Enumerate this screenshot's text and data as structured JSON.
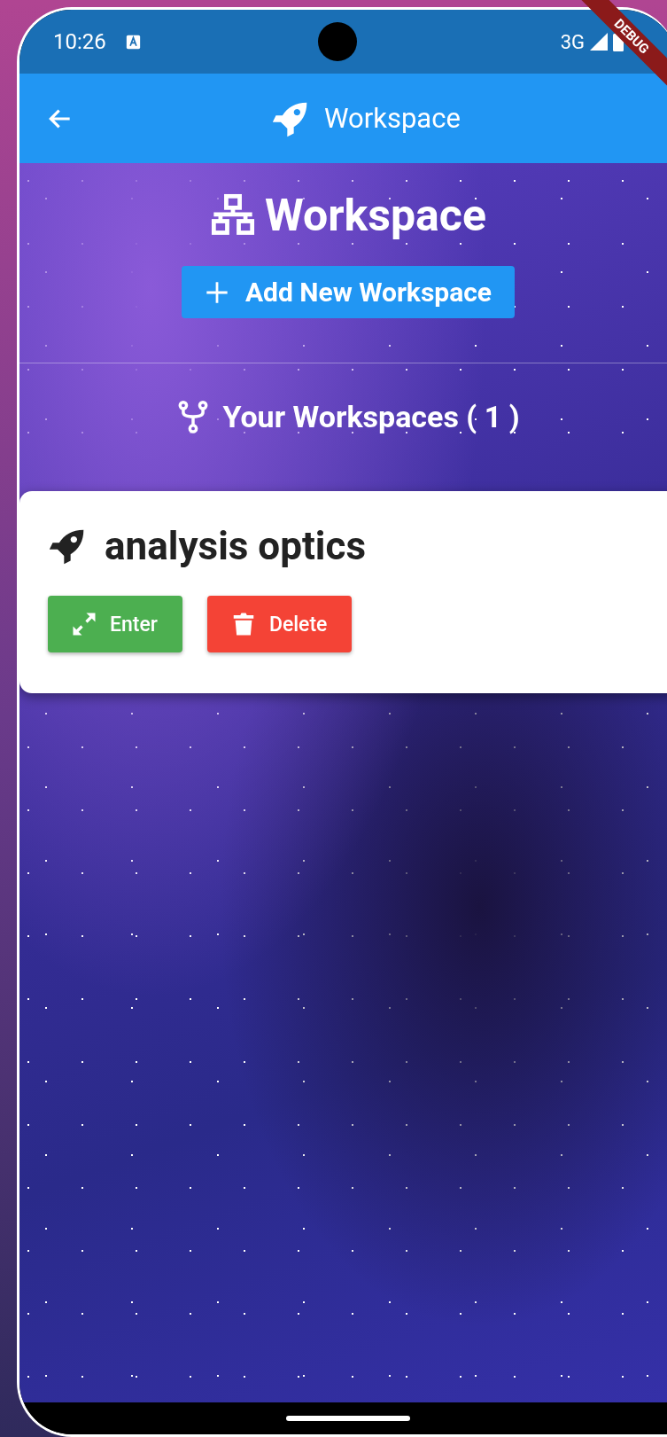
{
  "status_bar": {
    "time": "10:26",
    "network": "3G"
  },
  "debug_banner": "DEBUG",
  "app_bar": {
    "title": "Workspace"
  },
  "header": {
    "title": "Workspace",
    "add_button": "Add New Workspace"
  },
  "section_title": "Your Workspaces ( 1 )",
  "workspaces": [
    {
      "name": "analysis optics",
      "actions": [
        {
          "kind": "enter",
          "label": "Enter"
        },
        {
          "kind": "delete",
          "label": "Delete"
        }
      ]
    }
  ]
}
